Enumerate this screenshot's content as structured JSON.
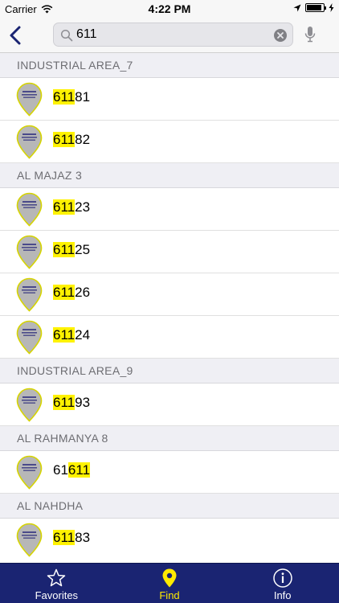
{
  "status_bar": {
    "carrier": "Carrier",
    "time": "4:22 PM",
    "battery_level": 0.9
  },
  "search": {
    "query": "611",
    "back_icon": "chevron-left-icon",
    "clear_icon": "clear-icon",
    "mic_icon": "microphone-icon"
  },
  "sections": [
    {
      "title": "INDUSTRIAL AREA_7",
      "items": [
        {
          "before": "",
          "match": "611",
          "after": "81"
        },
        {
          "before": "",
          "match": "611",
          "after": "82"
        }
      ]
    },
    {
      "title": "AL MAJAZ 3",
      "items": [
        {
          "before": "",
          "match": "611",
          "after": "23"
        },
        {
          "before": "",
          "match": "611",
          "after": "25"
        },
        {
          "before": "",
          "match": "611",
          "after": "26"
        },
        {
          "before": "",
          "match": "611",
          "after": "24"
        }
      ]
    },
    {
      "title": "INDUSTRIAL AREA_9",
      "items": [
        {
          "before": "",
          "match": "611",
          "after": "93"
        }
      ]
    },
    {
      "title": "AL RAHMANYA 8",
      "items": [
        {
          "before": "61",
          "match": "611",
          "after": ""
        }
      ]
    },
    {
      "title": "AL NAHDHA",
      "items": [
        {
          "before": "",
          "match": "611",
          "after": "83"
        }
      ]
    }
  ],
  "tabs": [
    {
      "label": "Favorites",
      "icon": "star-icon",
      "active": false
    },
    {
      "label": "Find",
      "icon": "location-pin-icon",
      "active": true
    },
    {
      "label": "Info",
      "icon": "info-icon",
      "active": false
    }
  ],
  "colors": {
    "tab_bar": "#1a2472",
    "active_tab": "#ffea00",
    "highlight": "#fff200",
    "back_arrow": "#1a2472",
    "pin": "#b7b7b7",
    "pin_outline": "#d6d400"
  }
}
